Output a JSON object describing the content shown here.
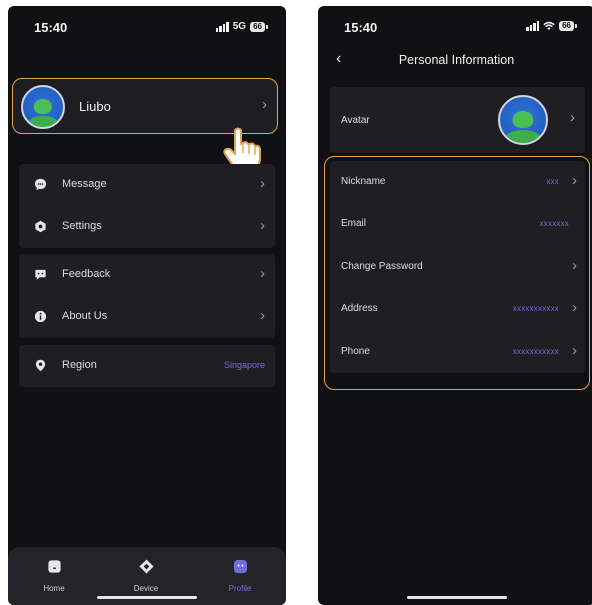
{
  "left_screen": {
    "status": {
      "time": "15:40",
      "network": "5G",
      "battery": "66"
    },
    "profile": {
      "name": "Liubo"
    },
    "menu_groups": [
      [
        {
          "label": "Message",
          "icon": "chat-bubble-icon"
        },
        {
          "label": "Settings",
          "icon": "hexagon-settings-icon"
        }
      ],
      [
        {
          "label": "Feedback",
          "icon": "feedback-icon"
        },
        {
          "label": "About Us",
          "icon": "info-icon"
        }
      ],
      [
        {
          "label": "Region",
          "icon": "location-pin-icon",
          "value": "Singapore"
        }
      ]
    ],
    "bottom_nav": [
      {
        "label": "Home",
        "icon": "home-icon",
        "active": false
      },
      {
        "label": "Device",
        "icon": "device-icon",
        "active": false
      },
      {
        "label": "Profile",
        "icon": "profile-icon",
        "active": true
      }
    ]
  },
  "right_screen": {
    "status": {
      "time": "15:40",
      "battery": "66"
    },
    "header": {
      "title": "Personal Information"
    },
    "avatar_row": {
      "label": "Avatar"
    },
    "info_rows": [
      {
        "label": "Nickname",
        "value": "xxx"
      },
      {
        "label": "Email",
        "value": "xxxxxxx"
      },
      {
        "label": "Change Password",
        "value": ""
      },
      {
        "label": "Address",
        "value": "xxxxxxxxxxx"
      },
      {
        "label": "Phone",
        "value": "xxxxxxxxxxx"
      }
    ]
  },
  "colors": {
    "accent": "#6f6fdc",
    "highlight_outline": "#e0a54a",
    "background": "#111114",
    "card": "#1e1e23"
  }
}
